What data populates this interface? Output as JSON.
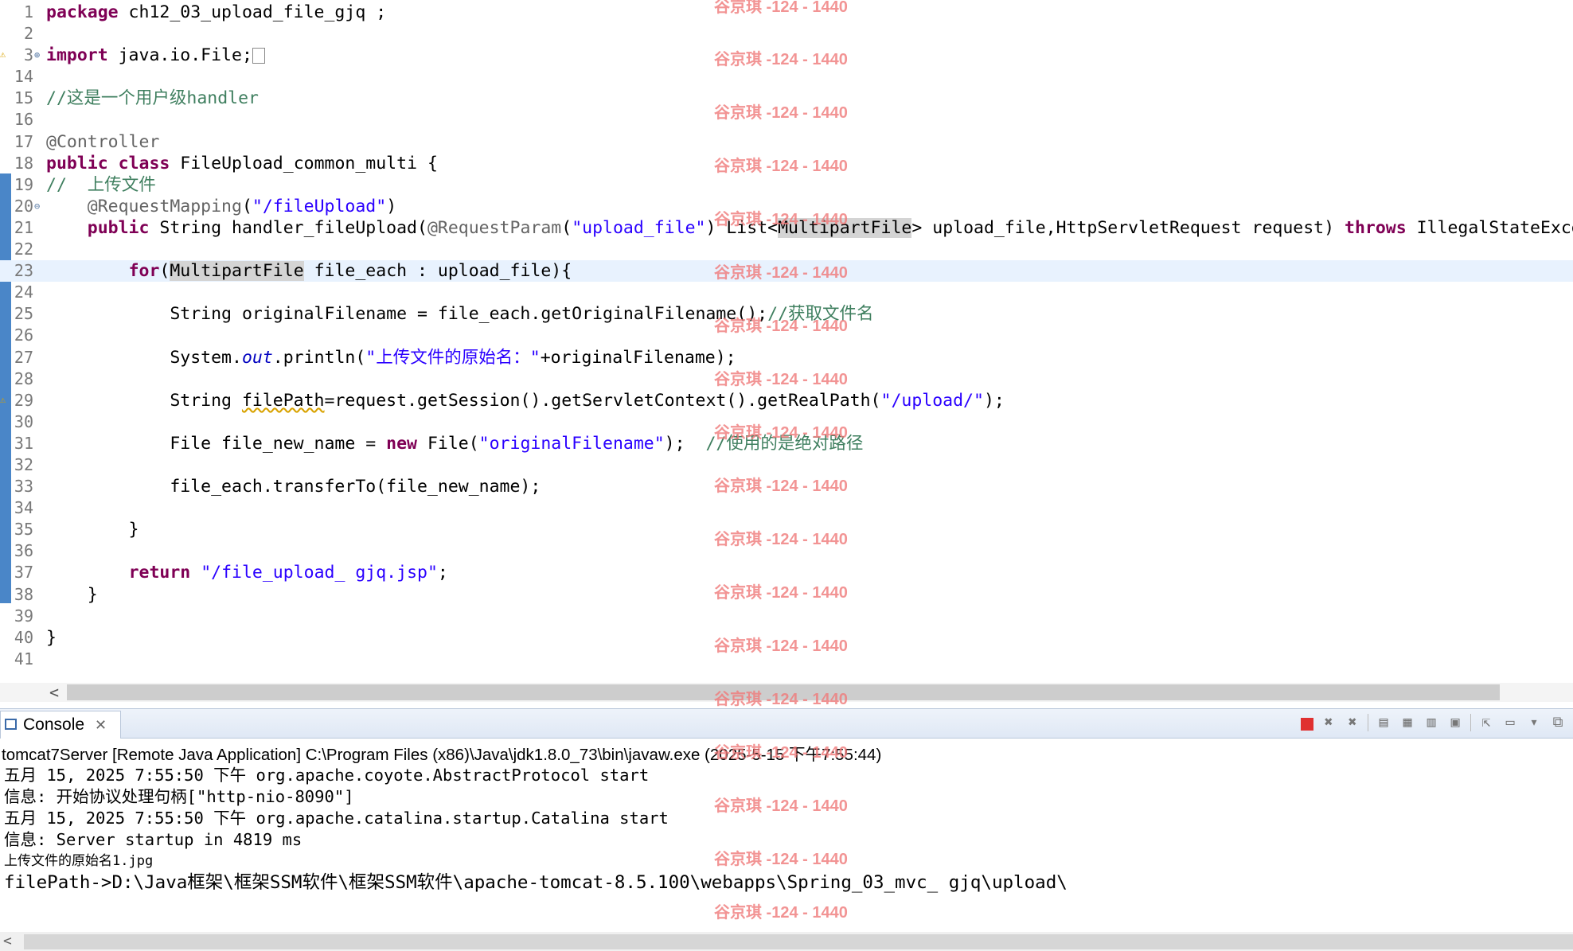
{
  "editor": {
    "lines": [
      {
        "num": "1",
        "tokens": [
          {
            "t": "package",
            "c": "kw"
          },
          {
            "t": " ch12_03_upload_file_gjq ;"
          }
        ]
      },
      {
        "num": "2",
        "tokens": []
      },
      {
        "num": "3",
        "fold": "plus",
        "warn": true,
        "tokens": [
          {
            "t": "import",
            "c": "kw"
          },
          {
            "t": " java.io.File;"
          },
          {
            "t": "[]",
            "c": "box"
          }
        ]
      },
      {
        "num": "14",
        "tokens": []
      },
      {
        "num": "15",
        "tokens": [
          {
            "t": "//这是一个用户级handler",
            "c": "cmt"
          }
        ]
      },
      {
        "num": "16",
        "tokens": []
      },
      {
        "num": "17",
        "tokens": [
          {
            "t": "@Controller",
            "c": "ann"
          }
        ]
      },
      {
        "num": "18",
        "tokens": [
          {
            "t": "public",
            "c": "kw"
          },
          {
            "t": " "
          },
          {
            "t": "class",
            "c": "kw"
          },
          {
            "t": " FileUpload_common_multi {"
          }
        ]
      },
      {
        "num": "19",
        "tokens": [
          {
            "t": "//  上传文件",
            "c": "cmt"
          }
        ]
      },
      {
        "num": "20",
        "fold": "minus",
        "tokens": [
          {
            "t": "    "
          },
          {
            "t": "@RequestMapping",
            "c": "ann"
          },
          {
            "t": "("
          },
          {
            "t": "\"/fileUpload\"",
            "c": "str"
          },
          {
            "t": ")"
          }
        ]
      },
      {
        "num": "21",
        "tokens": [
          {
            "t": "    "
          },
          {
            "t": "public",
            "c": "kw"
          },
          {
            "t": " String handler_fileUpload("
          },
          {
            "t": "@RequestParam",
            "c": "ann"
          },
          {
            "t": "("
          },
          {
            "t": "\"upload_file\"",
            "c": "str"
          },
          {
            "t": ") List<"
          },
          {
            "t": "MultipartFile",
            "c": "hl"
          },
          {
            "t": "> upload_file,HttpServletRequest request) "
          },
          {
            "t": "throws",
            "c": "kw"
          },
          {
            "t": " IllegalStateException, I"
          }
        ]
      },
      {
        "num": "22",
        "tokens": []
      },
      {
        "num": "23",
        "current": true,
        "tokens": [
          {
            "t": "        "
          },
          {
            "t": "for",
            "c": "kw"
          },
          {
            "t": "("
          },
          {
            "t": "MultipartFile",
            "c": "hl"
          },
          {
            "t": " file_each : upload_file){"
          }
        ]
      },
      {
        "num": "24",
        "tokens": []
      },
      {
        "num": "25",
        "tokens": [
          {
            "t": "            String originalFilename = file_each.getOriginalFilename();"
          },
          {
            "t": "//获取文件名",
            "c": "cmt"
          }
        ]
      },
      {
        "num": "26",
        "tokens": []
      },
      {
        "num": "27",
        "tokens": [
          {
            "t": "            System."
          },
          {
            "t": "out",
            "c": "fld"
          },
          {
            "t": ".println("
          },
          {
            "t": "\"上传文件的原始名：\"",
            "c": "str"
          },
          {
            "t": "+originalFilename);"
          }
        ]
      },
      {
        "num": "28",
        "tokens": []
      },
      {
        "num": "29",
        "warn": true,
        "tokens": [
          {
            "t": "            String "
          },
          {
            "t": "filePath",
            "c": "warnvar"
          },
          {
            "t": "=request.getSession().getServletContext().getRealPath("
          },
          {
            "t": "\"/upload/\"",
            "c": "str"
          },
          {
            "t": ");"
          }
        ]
      },
      {
        "num": "30",
        "tokens": []
      },
      {
        "num": "31",
        "tokens": [
          {
            "t": "            File file_new_name = "
          },
          {
            "t": "new",
            "c": "kw"
          },
          {
            "t": " File("
          },
          {
            "t": "\"originalFilename\"",
            "c": "str"
          },
          {
            "t": ");  "
          },
          {
            "t": "//使用的是绝对路径",
            "c": "cmt"
          }
        ]
      },
      {
        "num": "32",
        "tokens": []
      },
      {
        "num": "33",
        "tokens": [
          {
            "t": "            file_each.transferTo(file_new_name);"
          }
        ]
      },
      {
        "num": "34",
        "tokens": []
      },
      {
        "num": "35",
        "tokens": [
          {
            "t": "        }"
          }
        ]
      },
      {
        "num": "36",
        "tokens": []
      },
      {
        "num": "37",
        "tokens": [
          {
            "t": "        "
          },
          {
            "t": "return",
            "c": "kw"
          },
          {
            "t": " "
          },
          {
            "t": "\"/file_upload_ gjq.jsp\"",
            "c": "str"
          },
          {
            "t": ";"
          }
        ]
      },
      {
        "num": "38",
        "tokens": [
          {
            "t": "    }"
          }
        ]
      },
      {
        "num": "39",
        "tokens": []
      },
      {
        "num": "40",
        "tokens": [
          {
            "t": "}"
          }
        ]
      },
      {
        "num": "41",
        "tokens": []
      }
    ],
    "scroll_left_arrow": "<"
  },
  "console": {
    "tab_label": "Console",
    "tab_close": "✕",
    "header": "tomcat7Server [Remote Java Application] C:\\Program Files (x86)\\Java\\jdk1.8.0_73\\bin\\javaw.exe (2025-5-15 下午7:55:44)",
    "lines": [
      {
        "text": "五月 15, 2025 7:55:50 下午 org.apache.coyote.AbstractProtocol start",
        "size": "normal"
      },
      {
        "text": "信息: 开始协议处理句柄[\"http-nio-8090\"]",
        "size": "normal"
      },
      {
        "text": "五月 15, 2025 7:55:50 下午 org.apache.catalina.startup.Catalina start",
        "size": "normal"
      },
      {
        "text": "信息: Server startup in 4819 ms",
        "size": "normal"
      },
      {
        "text": "上传文件的原始名1.jpg",
        "size": "small"
      },
      {
        "text": "filePath->D:\\Java框架\\框架SSM软件\\框架SSM软件\\apache-tomcat-8.5.100\\webapps\\Spring_03_mvc_ gjq\\upload\\",
        "size": "big"
      }
    ],
    "scroll_left_arrow": "<",
    "toolbar": [
      {
        "name": "terminate-icon",
        "glyph": ""
      },
      {
        "name": "remove-launch-icon",
        "glyph": "✖"
      },
      {
        "name": "remove-all-launches-icon",
        "glyph": "✖"
      },
      {
        "name": "clear-console-icon",
        "glyph": "▤"
      },
      {
        "name": "scroll-lock-icon",
        "glyph": "▦"
      },
      {
        "name": "word-wrap-icon",
        "glyph": "▥"
      },
      {
        "name": "show-console-icon",
        "glyph": "▣"
      },
      {
        "name": "pin-console-icon",
        "glyph": "⇱"
      },
      {
        "name": "display-selected-console-icon",
        "glyph": "▭"
      },
      {
        "name": "console-menu-icon",
        "glyph": "▾"
      },
      {
        "name": "open-console-icon",
        "glyph": "⧉"
      }
    ]
  },
  "watermark": "谷京琪 -124 - 1440"
}
